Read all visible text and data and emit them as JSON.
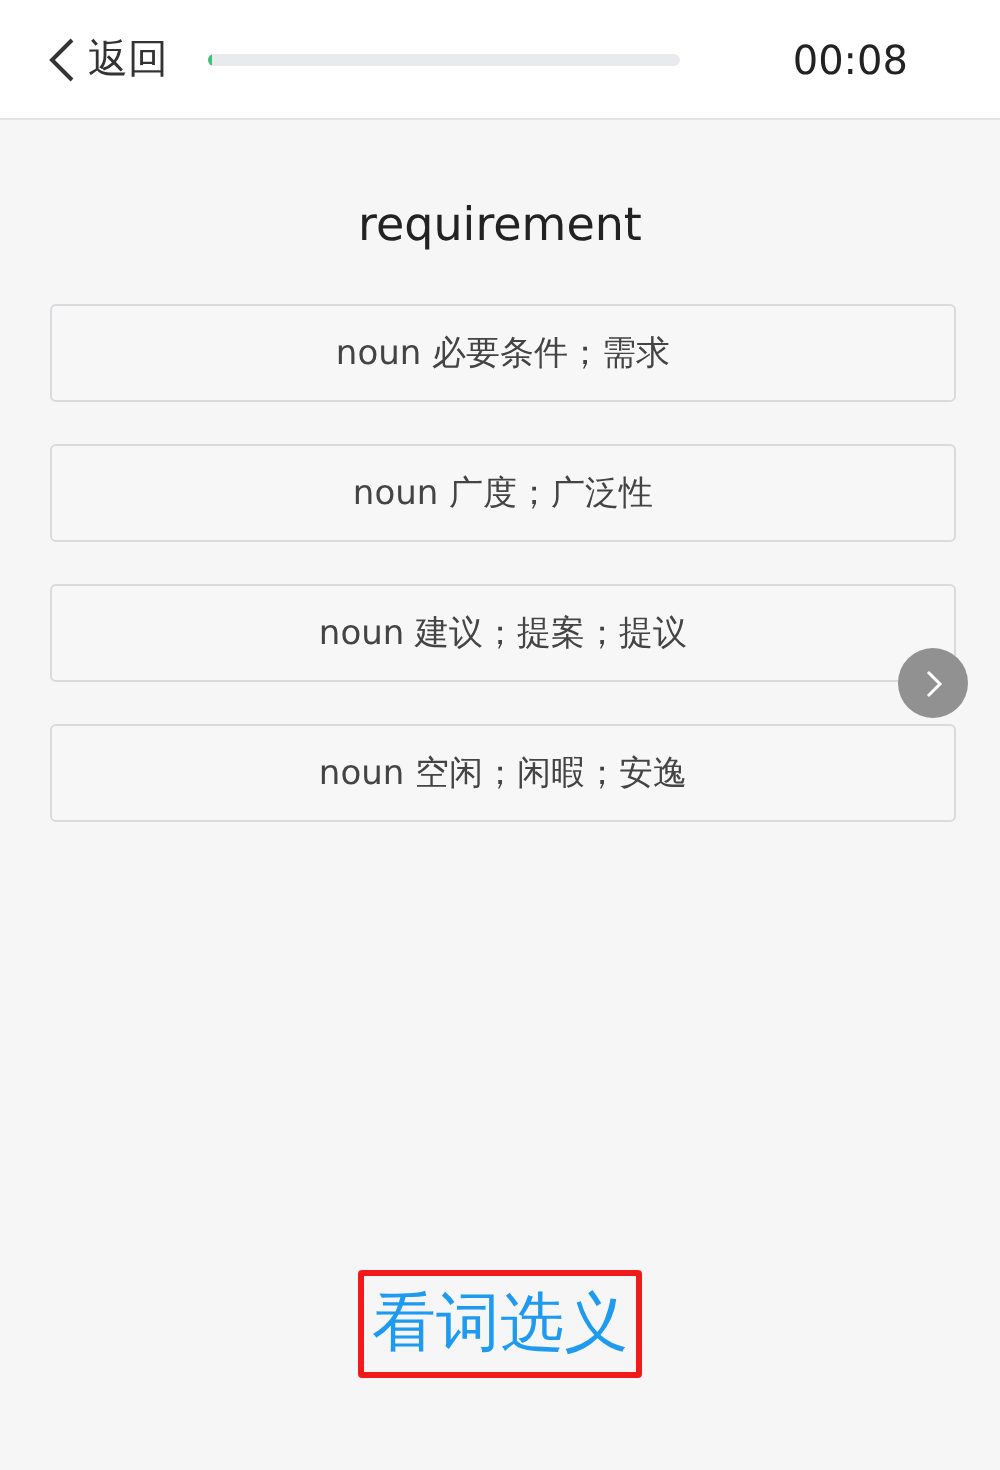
{
  "header": {
    "back": "返回",
    "progress": {
      "level": 0.01
    },
    "timer": "00:08"
  },
  "word": "requirement",
  "options": [
    {
      "text": "noun 必要条件；需求",
      "selected": false
    },
    {
      "text": "noun 广度；广泛性",
      "selected": false
    },
    {
      "text": "noun 建议；提案；提议",
      "selected": false
    },
    {
      "text": "noun 空闲；闲暇；安逸",
      "selected": false
    }
  ],
  "mode": {
    "label": "看词选义",
    "highlighted": true
  }
}
